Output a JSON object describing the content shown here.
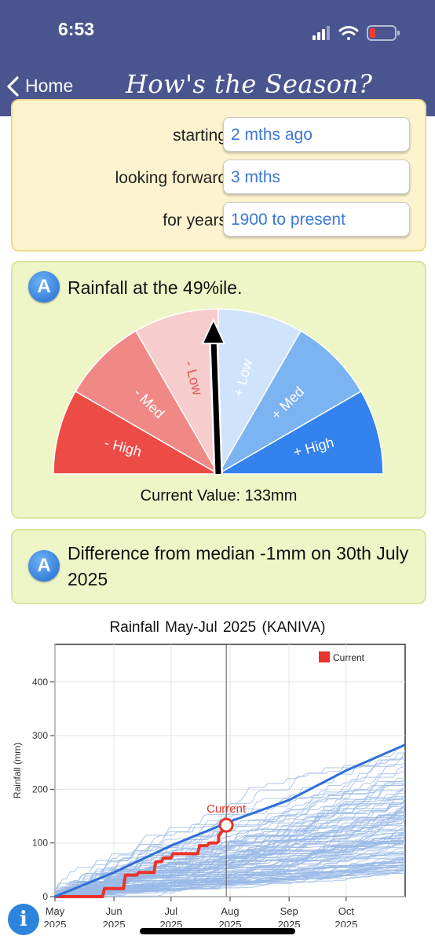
{
  "status": {
    "time": "6:53"
  },
  "nav": {
    "back_label": "Home",
    "title": "How's the Season?"
  },
  "settings": [
    {
      "label": "starting",
      "value": "2 mths ago"
    },
    {
      "label": "looking forward",
      "value": "3 mths"
    },
    {
      "label": "for years",
      "value": "1900 to present"
    }
  ],
  "rainfall_card": {
    "badge": "A",
    "title": "Rainfall at the 49%ile.",
    "gauge_segments": [
      "- High",
      "- Med",
      "- Low",
      "+ Low",
      "+ Med",
      "+ High"
    ],
    "percentile": 49,
    "current_value": "Current Value: 133mm"
  },
  "diff_card": {
    "badge": "A",
    "text": "Difference from median -1mm on 30th July 2025"
  },
  "chart_title": "Rainfall     May-Jul 2025  (KANIVA)",
  "info_icon": "i",
  "chart_data": {
    "type": "line",
    "title": "Rainfall     May-Jul 2025  (KANIVA)",
    "ylabel": "Rainfall (mm)",
    "xlabel": "",
    "ylim": [
      0,
      470
    ],
    "y_ticks": [
      0,
      100,
      200,
      300,
      400
    ],
    "x_ticks": [
      {
        "label": [
          "May",
          "2025"
        ],
        "day": 0
      },
      {
        "label": [
          "Jun",
          "2025"
        ],
        "day": 31
      },
      {
        "label": [
          "Jul",
          "2025"
        ],
        "day": 61
      },
      {
        "label": [
          "Aug",
          "2025"
        ],
        "day": 92
      },
      {
        "label": [
          "Sep",
          "2025"
        ],
        "day": 123
      },
      {
        "label": [
          "Oct",
          "2025"
        ],
        "day": 153
      }
    ],
    "xlim_days": [
      0,
      184
    ],
    "current_day": 90,
    "legend": {
      "label": "Current",
      "position": "top-right"
    },
    "current_marker_label": "Current",
    "series": [
      {
        "name": "Current",
        "color": "#e8342a",
        "x": [
          0,
          25,
          26,
          36,
          37,
          43,
          44,
          52,
          53,
          56,
          57,
          61,
          62,
          75,
          76,
          80,
          81,
          85,
          86,
          86,
          87,
          90
        ],
        "y": [
          0,
          0,
          15,
          15,
          40,
          40,
          45,
          45,
          65,
          65,
          72,
          72,
          80,
          80,
          95,
          95,
          100,
          100,
          103,
          113,
          118,
          133
        ]
      },
      {
        "color": "#2f6fd6",
        "x": [
          0,
          31,
          61,
          92,
          123,
          153,
          184
        ],
        "y": [
          0,
          45,
          95,
          140,
          180,
          235,
          283
        ]
      }
    ],
    "colors": {
      "history": "#9ab9e6",
      "median": "#2f6fd6",
      "current": "#e8342a"
    }
  },
  "colors": {
    "status_bar": "#4a5590",
    "settings_bg": "#fdf4cf",
    "card_bg": "#eef6c7",
    "field_text": "#3b78d4",
    "gauge": [
      "#ec4b46",
      "#f08986",
      "#f6cccc",
      "#cfe3fb",
      "#7cb3f1",
      "#3382ee"
    ]
  }
}
